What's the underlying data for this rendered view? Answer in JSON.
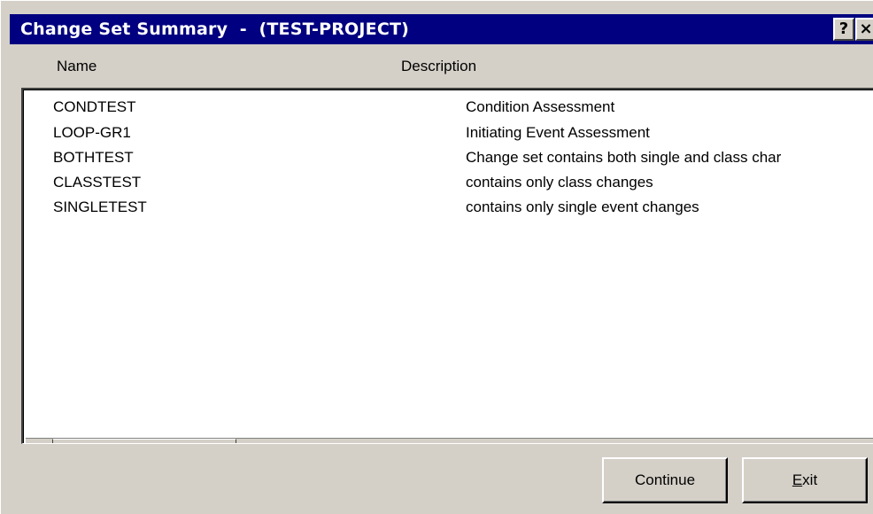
{
  "window": {
    "title": "Change Set Summary  -  (TEST-PROJECT)",
    "help_label": "?",
    "close_label": "×"
  },
  "columns": {
    "name": "Name",
    "description": "Description"
  },
  "rows": [
    {
      "name": "CONDTEST",
      "description": "Condition Assessment"
    },
    {
      "name": "LOOP-GR1",
      "description": "Initiating Event Assessment"
    },
    {
      "name": "BOTHTEST",
      "description": "Change set contains both single and class char"
    },
    {
      "name": "CLASSTEST",
      "description": "contains only class changes"
    },
    {
      "name": "SINGLETEST",
      "description": "contains only single event changes"
    }
  ],
  "buttons": {
    "continue_label": "Continue",
    "exit_mnemonic": "E",
    "exit_rest": "xit"
  },
  "colors": {
    "titlebar": "#000080",
    "face": "#d4d0c8",
    "list_bg": "#ffffff"
  }
}
